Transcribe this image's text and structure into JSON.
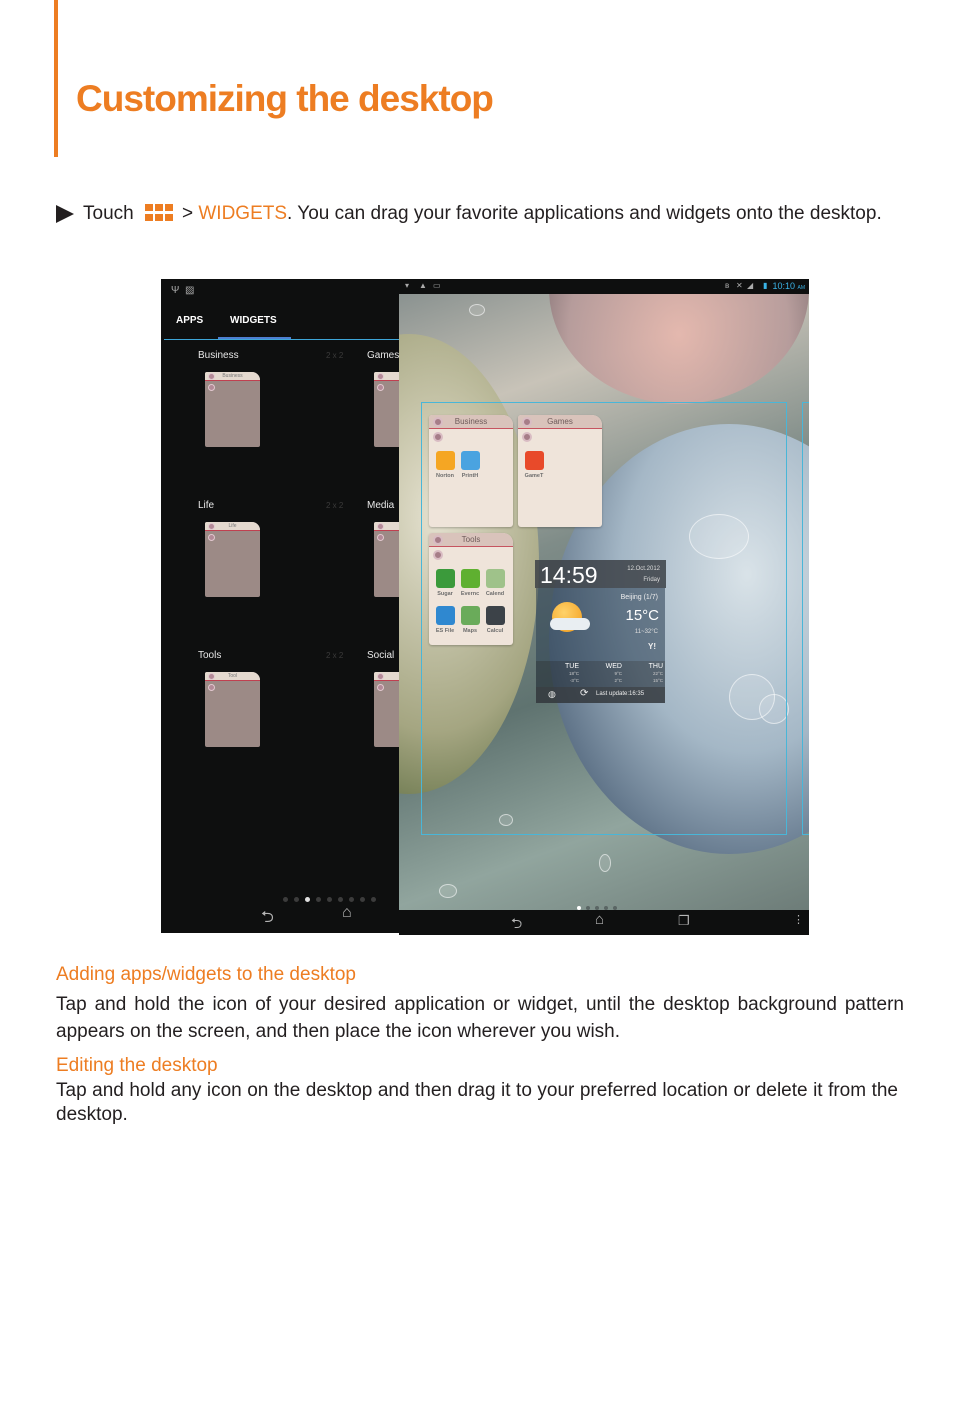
{
  "page": {
    "title": "Customizing the desktop",
    "accent_color": "#ed7d22"
  },
  "step": {
    "prefix": "Touch",
    "separator": ">",
    "link": "WIDGETS",
    "suffix": ". You can drag your favorite applications and widgets onto the desktop.",
    "icon": "apps-grid-icon"
  },
  "left_screen": {
    "status_icons": [
      "usb-icon",
      "sd-card-icon"
    ],
    "tabs": [
      {
        "label": "APPS",
        "selected": false
      },
      {
        "label": "WIDGETS",
        "selected": true
      }
    ],
    "widgets": [
      {
        "name": "Business",
        "size": "2 x 2",
        "header": "Business"
      },
      {
        "name": "Games",
        "size": "",
        "header": "G"
      },
      {
        "name": "Life",
        "size": "2 x 2",
        "header": "Life"
      },
      {
        "name": "Media",
        "size": "",
        "header": "M"
      },
      {
        "name": "Tools",
        "size": "2 x 2",
        "header": "Tool"
      },
      {
        "name": "Social",
        "size": "",
        "header": "S"
      }
    ],
    "page_indicator": {
      "count": 9,
      "active_index": 2
    },
    "nav": [
      "back-icon",
      "home-icon"
    ]
  },
  "right_screen": {
    "status_left_icons": [
      "wifi-icon",
      "warning-icon",
      "screenshot-icon"
    ],
    "status_right_icons": [
      "bluetooth-icon",
      "mute-icon",
      "signal-icon",
      "battery-icon"
    ],
    "time": "10:10",
    "time_suffix": "AM",
    "folders": [
      {
        "title": "Business",
        "apps": [
          {
            "label": "Norton",
            "color": "#f5a623"
          },
          {
            "label": "PrintH",
            "color": "#4aa3e0"
          }
        ]
      },
      {
        "title": "Games",
        "apps": [
          {
            "label": "GameT",
            "color": "#e84a2a"
          }
        ]
      },
      {
        "title": "Tools",
        "apps": [
          {
            "label": "Sugar",
            "color": "#3b9a3b"
          },
          {
            "label": "Evernc",
            "color": "#5fb030"
          },
          {
            "label": "Calend",
            "color": "#9fc28a"
          },
          {
            "label": "ES File",
            "color": "#2f88d0"
          },
          {
            "label": "Maps",
            "color": "#6aab5a"
          },
          {
            "label": "Calcul",
            "color": "#3c4248"
          }
        ]
      }
    ],
    "weather_widget": {
      "time": "14:59",
      "date": "12.Oct.2012",
      "weekday": "Friday",
      "city": "Beijing (1/7)",
      "temperature": "15°C",
      "range": "11~32°C",
      "provider": "Y!",
      "forecast": [
        {
          "day": "TUE",
          "high": "18°C",
          "low": "-3°C"
        },
        {
          "day": "WED",
          "high": "9°C",
          "low": "2°C"
        },
        {
          "day": "THU",
          "high": "22°C",
          "low": "15°C"
        }
      ],
      "last_update": "Last update:16:35"
    },
    "page_indicator": {
      "count": 5,
      "active_index": 0
    },
    "nav": [
      "back-icon",
      "home-icon",
      "recent-apps-icon",
      "menu-icon"
    ]
  },
  "sections": [
    {
      "heading": "Adding apps/widgets to the desktop",
      "body": "Tap and hold the icon of your desired application or widget, until the desktop background pattern appears on the screen, and then place the icon wherever you wish."
    },
    {
      "heading": "Editing the desktop",
      "body": "Tap and hold any icon on the desktop and then drag it to your preferred location or delete it from the desktop."
    }
  ]
}
